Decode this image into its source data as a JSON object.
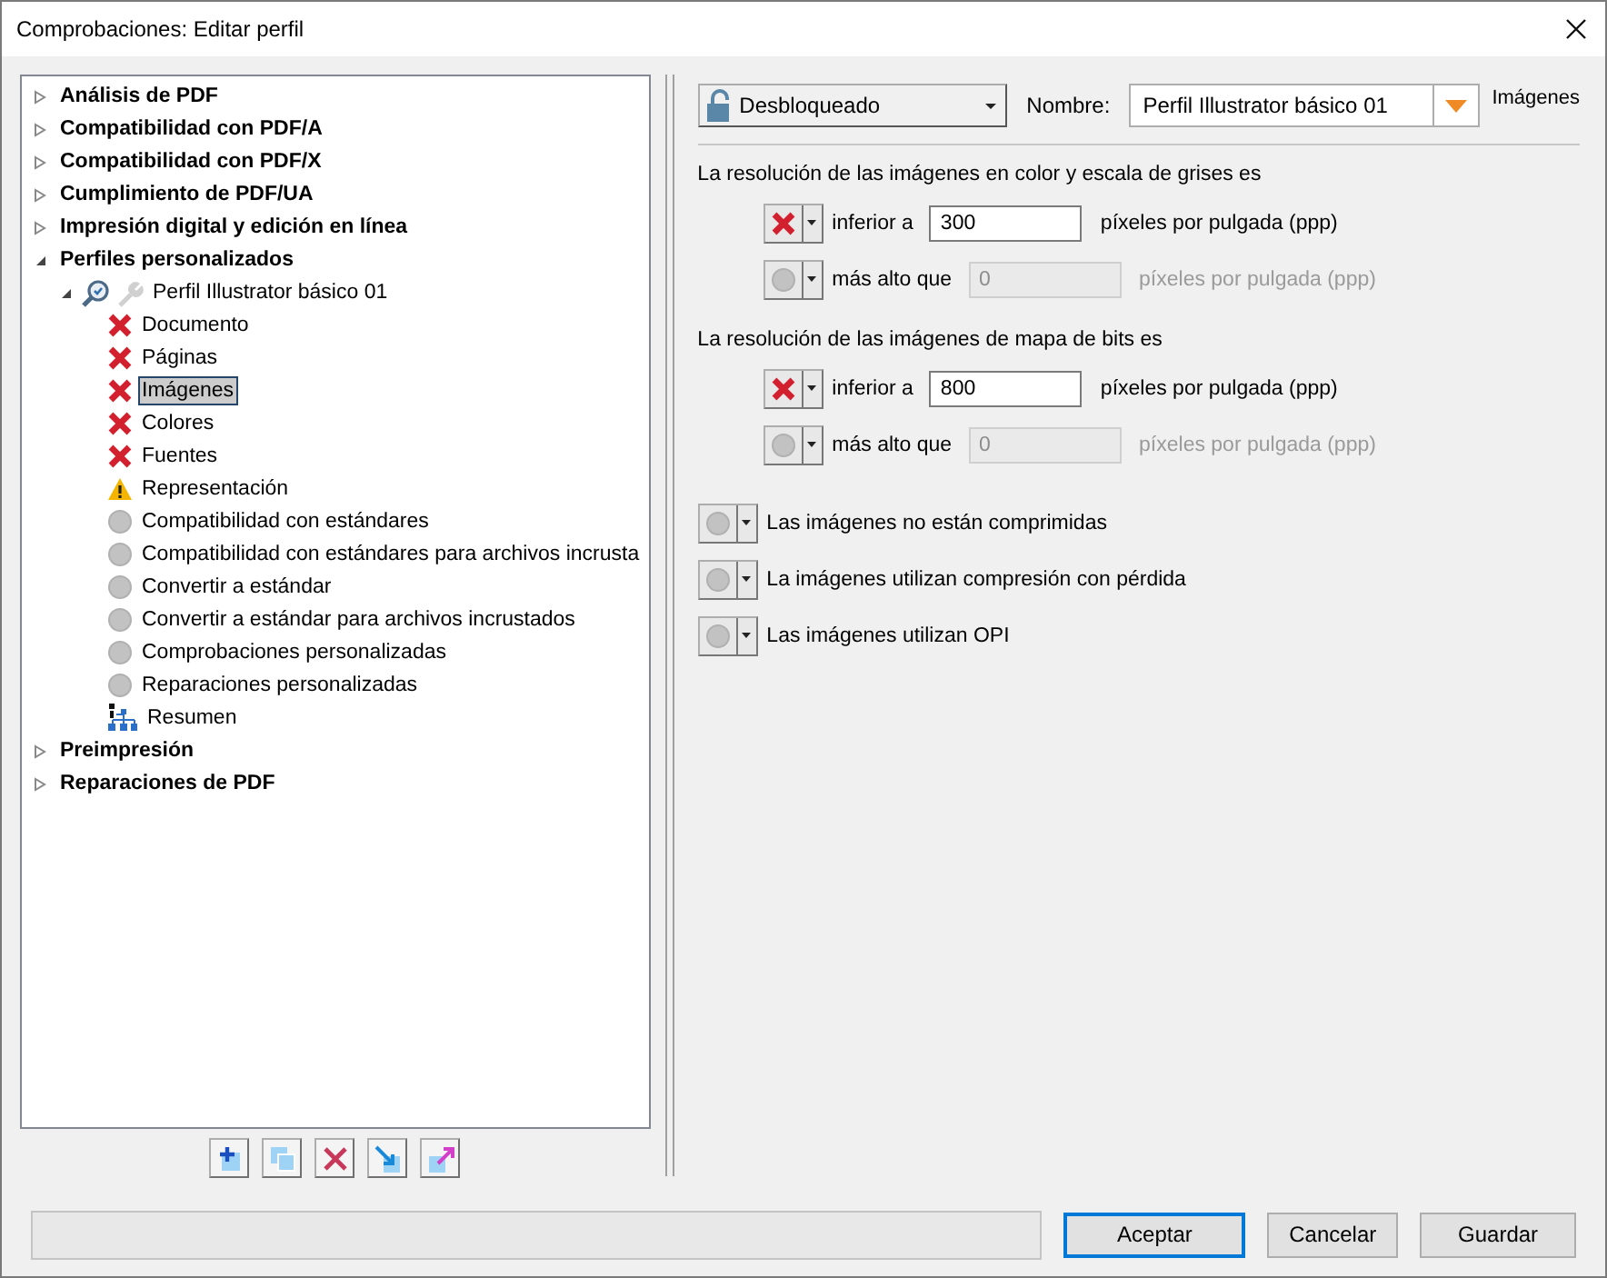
{
  "window": {
    "title": "Comprobaciones: Editar perfil"
  },
  "tree": [
    {
      "label": "Análisis de PDF",
      "expanded": false,
      "selected": false
    },
    {
      "label": "Compatibilidad con PDF/A",
      "expanded": false,
      "selected": false
    },
    {
      "label": "Compatibilidad con PDF/X",
      "expanded": false,
      "selected": false
    },
    {
      "label": "Cumplimiento de PDF/UA",
      "expanded": false,
      "selected": false
    },
    {
      "label": "Impresión digital y edición en línea",
      "expanded": false,
      "selected": false
    },
    {
      "label": "Perfiles personalizados",
      "expanded": true,
      "selected": false,
      "children": [
        {
          "label": "Perfil Illustrator básico 01",
          "kind": "profile",
          "expanded": true,
          "selected": false,
          "children": [
            {
              "label": "Documento",
              "kind": "error",
              "selected": false
            },
            {
              "label": "Páginas",
              "kind": "error",
              "selected": false
            },
            {
              "label": "Imágenes",
              "kind": "error",
              "selected": true
            },
            {
              "label": "Colores",
              "kind": "error",
              "selected": false
            },
            {
              "label": "Fuentes",
              "kind": "error",
              "selected": false
            },
            {
              "label": "Representación",
              "kind": "warning",
              "selected": false
            },
            {
              "label": "Compatibilidad con estándares",
              "kind": "none",
              "selected": false
            },
            {
              "label": "Compatibilidad con estándares para archivos incrusta",
              "kind": "none",
              "selected": false
            },
            {
              "label": "Convertir a estándar",
              "kind": "none",
              "selected": false
            },
            {
              "label": "Convertir a estándar para archivos incrustados",
              "kind": "none",
              "selected": false
            },
            {
              "label": "Comprobaciones personalizadas",
              "kind": "none",
              "selected": false
            },
            {
              "label": "Reparaciones personalizadas",
              "kind": "none",
              "selected": false
            },
            {
              "label": "Resumen",
              "kind": "summary",
              "selected": false
            }
          ]
        }
      ]
    },
    {
      "label": "Preimpresión",
      "expanded": false,
      "selected": false
    },
    {
      "label": "Reparaciones de PDF",
      "expanded": false,
      "selected": false
    }
  ],
  "lock": {
    "label": "Desbloqueado"
  },
  "name": {
    "label": "Nombre:",
    "value": "Perfil Illustrator básico 01"
  },
  "section_title": "Imágenes",
  "groups": [
    {
      "heading": "La resolución de las imágenes en color y escala de grises es",
      "rules": [
        {
          "kind": "error",
          "label": "inferior a",
          "value": "300",
          "unit": "píxeles por pulgada (ppp)",
          "disabled": false
        },
        {
          "kind": "none",
          "label": "más alto que",
          "value": "0",
          "unit": "píxeles por pulgada (ppp)",
          "disabled": true
        }
      ]
    },
    {
      "heading": "La resolución de las imágenes de mapa de bits es",
      "rules": [
        {
          "kind": "error",
          "label": "inferior a",
          "value": "800",
          "unit": "píxeles por pulgada (ppp)",
          "disabled": false
        },
        {
          "kind": "none",
          "label": "más alto que",
          "value": "0",
          "unit": "píxeles por pulgada (ppp)",
          "disabled": true
        }
      ]
    }
  ],
  "checks": [
    {
      "kind": "none",
      "label": "Las imágenes no están comprimidas"
    },
    {
      "kind": "none",
      "label": "La imágenes utilizan compresión con pérdida"
    },
    {
      "kind": "none",
      "label": "Las imágenes utilizan OPI"
    }
  ],
  "buttons": [
    {
      "label": "Aceptar",
      "default": true
    },
    {
      "label": "Cancelar",
      "default": false
    },
    {
      "label": "Guardar",
      "default": false
    }
  ]
}
